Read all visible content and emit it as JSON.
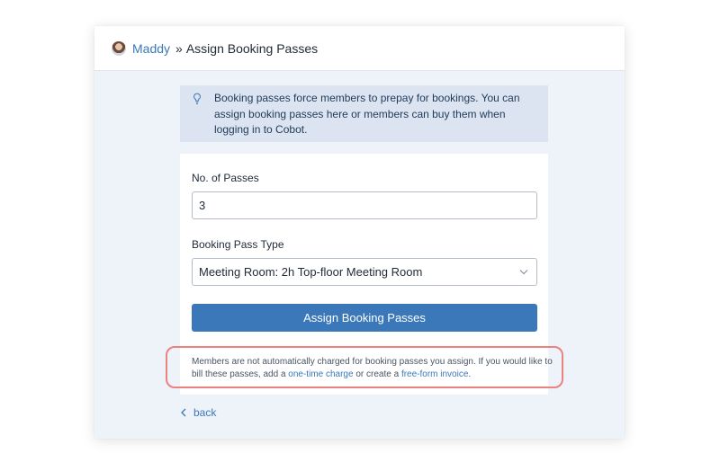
{
  "header": {
    "avatar_icon": "user-avatar",
    "member_name": "Maddy",
    "separator": "»",
    "page_title": "Assign Booking Passes"
  },
  "info": {
    "icon": "lightbulb-icon",
    "text": "Booking passes force members to prepay for bookings. You can assign booking passes here or members can buy them when logging in to Cobot."
  },
  "form": {
    "passes_label": "No. of Passes",
    "passes_value": "3",
    "type_label": "Booking Pass Type",
    "type_value": "Meeting Room: 2h Top-floor Meeting Room",
    "submit_label": "Assign Booking Passes"
  },
  "note": {
    "text_before": "Members are not automatically charged for booking passes you assign. If you would like to bill these passes, add a",
    "link_one_time": "one-time charge",
    "text_middle": "or create a",
    "link_invoice": "free-form invoice",
    "text_end": "."
  },
  "footer": {
    "back_label": "back",
    "back_icon": "chevron-left-icon"
  },
  "colors": {
    "accent": "#3b78b9",
    "link": "#3a78b8",
    "panel_bg": "#eef2f9",
    "info_bg": "#dbe4f0",
    "highlight_border": "#ea8380"
  }
}
